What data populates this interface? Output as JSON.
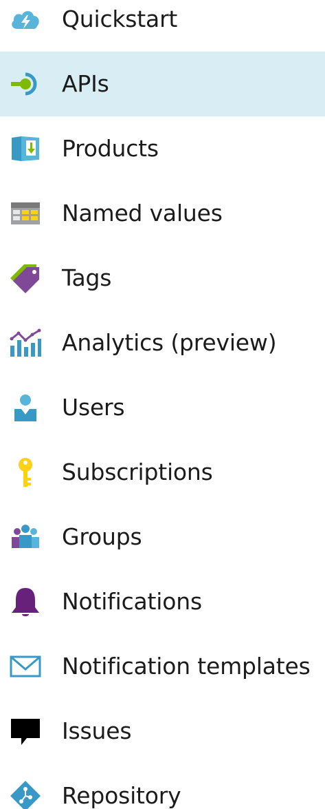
{
  "nav": {
    "selected_index": 1,
    "items": [
      {
        "label": "Quickstart",
        "icon": "cloud-bolt-icon"
      },
      {
        "label": "APIs",
        "icon": "api-plug-icon"
      },
      {
        "label": "Products",
        "icon": "product-box-icon"
      },
      {
        "label": "Named values",
        "icon": "table-grid-icon"
      },
      {
        "label": "Tags",
        "icon": "tags-icon"
      },
      {
        "label": "Analytics (preview)",
        "icon": "analytics-chart-icon"
      },
      {
        "label": "Users",
        "icon": "user-icon"
      },
      {
        "label": "Subscriptions",
        "icon": "key-icon"
      },
      {
        "label": "Groups",
        "icon": "groups-icon"
      },
      {
        "label": "Notifications",
        "icon": "bell-icon"
      },
      {
        "label": "Notification templates",
        "icon": "envelope-icon"
      },
      {
        "label": "Issues",
        "icon": "speech-bubble-icon"
      },
      {
        "label": "Repository",
        "icon": "repository-diamond-icon"
      }
    ]
  },
  "colors": {
    "selected_background": "#d9edf5",
    "azure_blue": "#3999c6",
    "api_green": "#7fba00",
    "tag_purple": "#804998",
    "key_yellow": "#fcd116",
    "bell_purple": "#68217a"
  }
}
